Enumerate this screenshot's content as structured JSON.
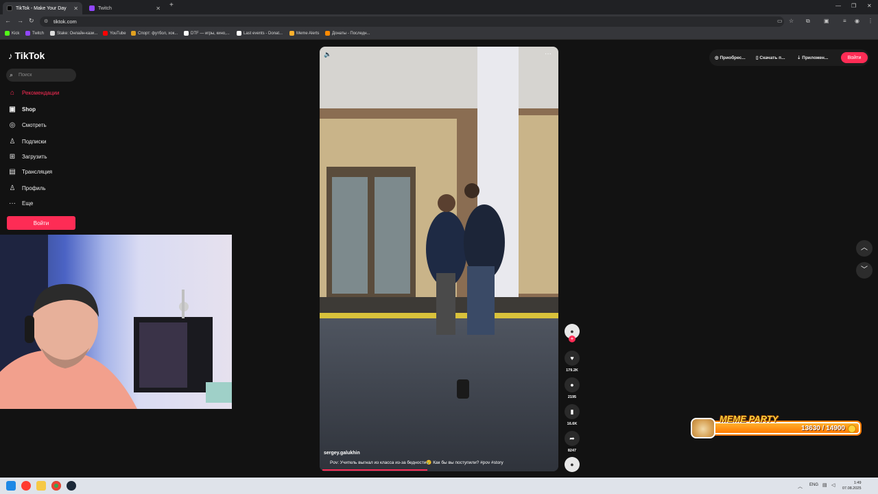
{
  "browser": {
    "tabs": [
      {
        "title": "TikTok - Make Your Day",
        "active": true
      },
      {
        "title": "Twitch",
        "active": false
      }
    ],
    "new_tab": "+",
    "url": "tiktok.com",
    "bookmarks": [
      {
        "label": "Kick",
        "color": "#53fc18"
      },
      {
        "label": "Twitch",
        "color": "#9146ff"
      },
      {
        "label": "Stake: Онлайн-кази...",
        "color": "#dddddd"
      },
      {
        "label": "YouTube",
        "color": "#ff0000"
      },
      {
        "label": "Спорт: футбол, хок...",
        "color": "#e0a020"
      },
      {
        "label": "DTF — игры, кино,...",
        "color": "#ffffff"
      },
      {
        "label": "Last events - Donat...",
        "color": "#ffffff"
      },
      {
        "label": "Meme Alerts",
        "color": "#ffb02d"
      },
      {
        "label": "Донаты - Последн...",
        "color": "#ff8a00"
      }
    ]
  },
  "sidebar": {
    "logo": "TikTok",
    "search_placeholder": "Поиск",
    "items": [
      {
        "label": "Рекомендации",
        "icon": "home-icon",
        "glyph": "⌂"
      },
      {
        "label": "Shop",
        "icon": "shop-icon",
        "glyph": "▣"
      },
      {
        "label": "Смотреть",
        "icon": "compass-icon",
        "glyph": "◎"
      },
      {
        "label": "Подписки",
        "icon": "following-icon",
        "glyph": "♙"
      },
      {
        "label": "Загрузить",
        "icon": "upload-icon",
        "glyph": "⊞"
      },
      {
        "label": "Трансляция",
        "icon": "live-icon",
        "glyph": "▤"
      },
      {
        "label": "Профиль",
        "icon": "profile-icon",
        "glyph": "♙"
      },
      {
        "label": "Еще",
        "icon": "more-icon",
        "glyph": "···"
      }
    ],
    "login_label": "Войти"
  },
  "video": {
    "username": "sergey.galukhin",
    "caption": "Pov: Учитель выгнал из класса из-за бедности😢 Как бы вы поступили? #pov #story",
    "progress": 0.45,
    "actions": {
      "likes": "179.2K",
      "comments": "2195",
      "saves": "16.6K",
      "shares": "8247"
    }
  },
  "header": {
    "buy_label": "Приобрес...",
    "download_label": "Скачать п...",
    "app_label": "Приложен...",
    "login_label": "Войти"
  },
  "widget": {
    "title": "MEME PARTY",
    "count": "13630 / 14900"
  },
  "taskbar": {
    "lang": "ENG",
    "time": "1:49",
    "date": "07.08.2025"
  }
}
